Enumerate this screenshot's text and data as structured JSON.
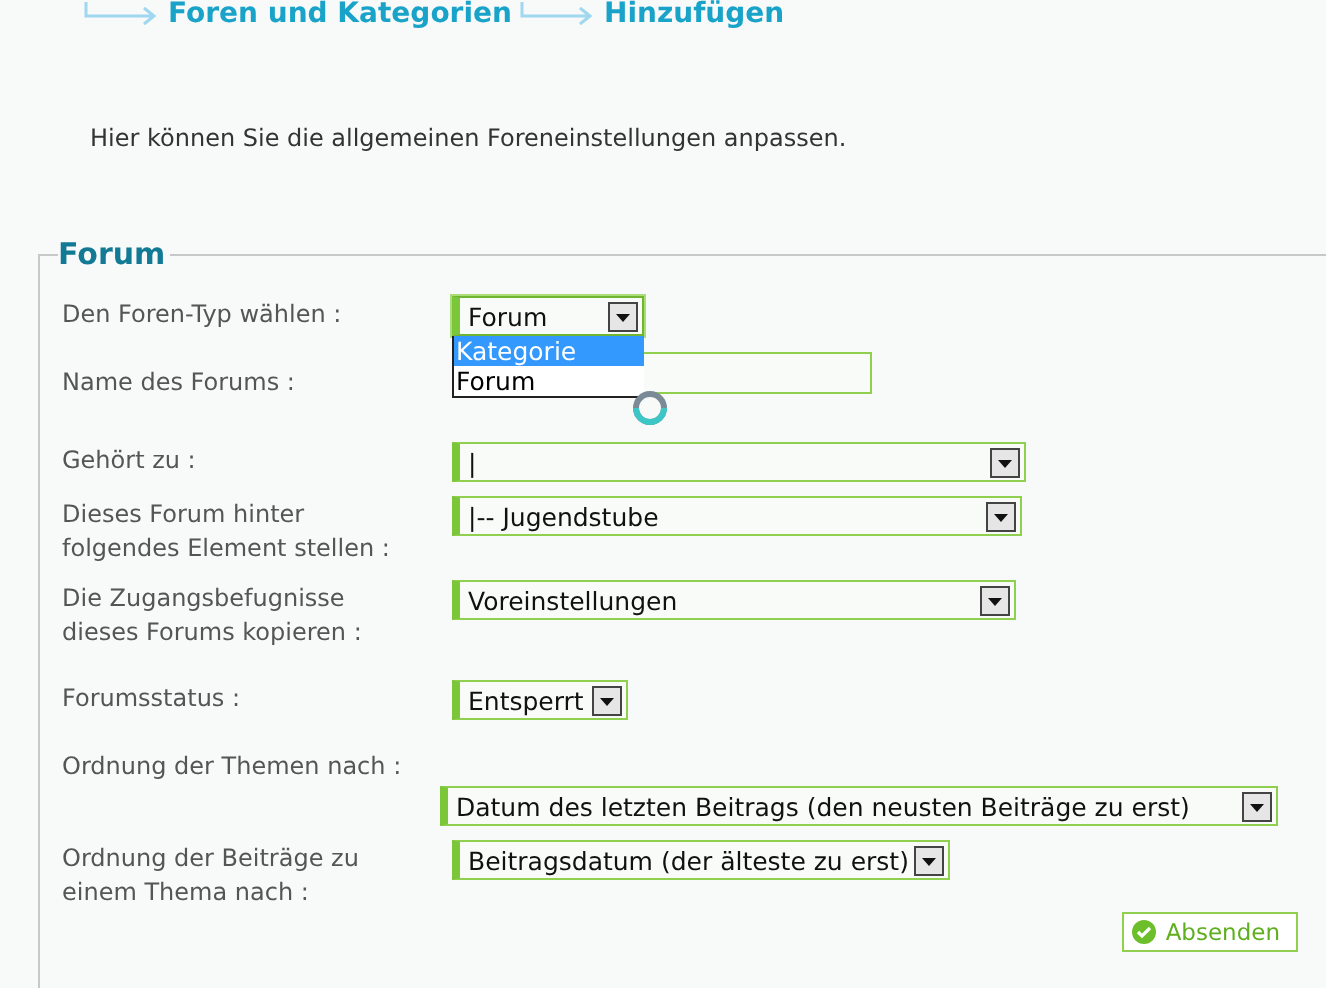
{
  "breadcrumb": [
    "Foren und Kategorien",
    "Hinzufügen"
  ],
  "intro": "Hier können Sie die allgemeinen Foreneinstellungen anpassen.",
  "fieldset": {
    "legend": "Forum",
    "fields": [
      {
        "kind": "select",
        "label": "Den Foren-Typ wählen :",
        "value": "Forum",
        "open": true,
        "options": [
          {
            "label": "Kategorie",
            "highlighted": true
          },
          {
            "label": "Forum",
            "highlighted": false
          }
        ]
      },
      {
        "kind": "text",
        "label": "Name des Forums :",
        "busy": true
      },
      {
        "kind": "select",
        "label": "Gehört zu :",
        "value": "|"
      },
      {
        "kind": "select",
        "label": "Dieses Forum hinter folgendes Element stellen :",
        "value": "|-- Jugendstube"
      },
      {
        "kind": "select",
        "label": "Die Zugangsbefugnisse dieses Forums kopieren :",
        "value": "Voreinstellungen"
      },
      {
        "kind": "select",
        "label": "Forumsstatus :",
        "value": "Entsperrt"
      },
      {
        "kind": "wide",
        "label": "Ordnung der Themen nach :",
        "value": "Datum des letzten Beitrags (den neusten Beiträge zu erst)"
      },
      {
        "kind": "select",
        "label": "Ordnung der Beiträge zu einem Thema nach :",
        "value": "Beitragsdatum (der älteste zu erst)"
      }
    ],
    "submit": "Absenden"
  }
}
